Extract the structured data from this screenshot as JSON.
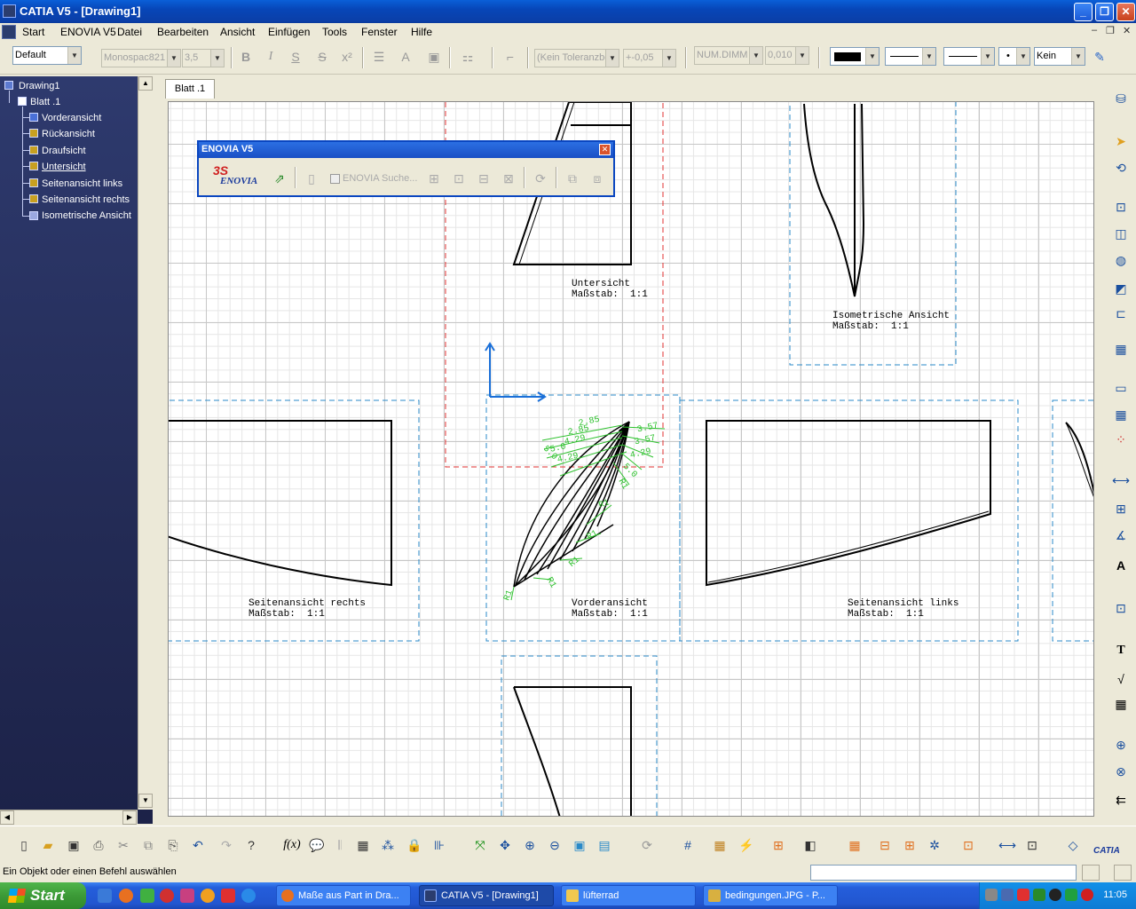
{
  "window": {
    "title": "CATIA V5 - [Drawing1]"
  },
  "menu": {
    "items": [
      "Start",
      "ENOVIA V5",
      "Datei",
      "Bearbeiten",
      "Ansicht",
      "Einfügen",
      "Tools",
      "Fenster",
      "Hilfe"
    ]
  },
  "format_toolbar": {
    "style": "Default",
    "font": "Monospac821",
    "font_size": "3,5",
    "tolerance": "(Kein Toleranzbe",
    "tol_value": "+-0,05",
    "num_format": "NUM.DIMM",
    "num_precision": "0,010",
    "line_end": "Kein"
  },
  "tree": {
    "root": "Drawing1",
    "sheet": "Blatt .1",
    "views": [
      "Vorderansicht",
      "Rückansicht",
      "Draufsicht",
      "Untersicht",
      "Seitenansicht links",
      "Seitenansicht rechts",
      "Isometrische Ansicht"
    ]
  },
  "drawing": {
    "tab": "Blatt .1",
    "views": [
      {
        "name": "Untersicht",
        "scale": "Maßstab:  1:1"
      },
      {
        "name": "Isometrische Ansicht",
        "scale": "Maßstab:  1:1"
      },
      {
        "name": "Seitenansicht rechts",
        "scale": "Maßstab:  1:1"
      },
      {
        "name": "Vorderansicht",
        "scale": "Maßstab:  1:1"
      },
      {
        "name": "Seitenansicht links",
        "scale": "Maßstab:  1:1"
      }
    ],
    "dimensions": [
      "2.85",
      "3.57",
      "2.85",
      "3.57",
      "4.29",
      "4.29",
      "5.0",
      "4.29",
      "5.0",
      "5.0",
      "R1",
      "R1",
      "R1",
      "R1",
      "R1",
      "R1"
    ]
  },
  "enovia_toolbar": {
    "title": "ENOVIA V5",
    "search_label": "ENOVIA Suche..."
  },
  "status": {
    "message": "Ein Objekt oder einen Befehl auswählen"
  },
  "taskbar": {
    "start": "Start",
    "tasks": [
      "Maße aus Part in Dra...",
      "CATIA V5 - [Drawing1]",
      "lüfterrad",
      "bedingungen.JPG - P..."
    ],
    "clock": "11:05"
  }
}
